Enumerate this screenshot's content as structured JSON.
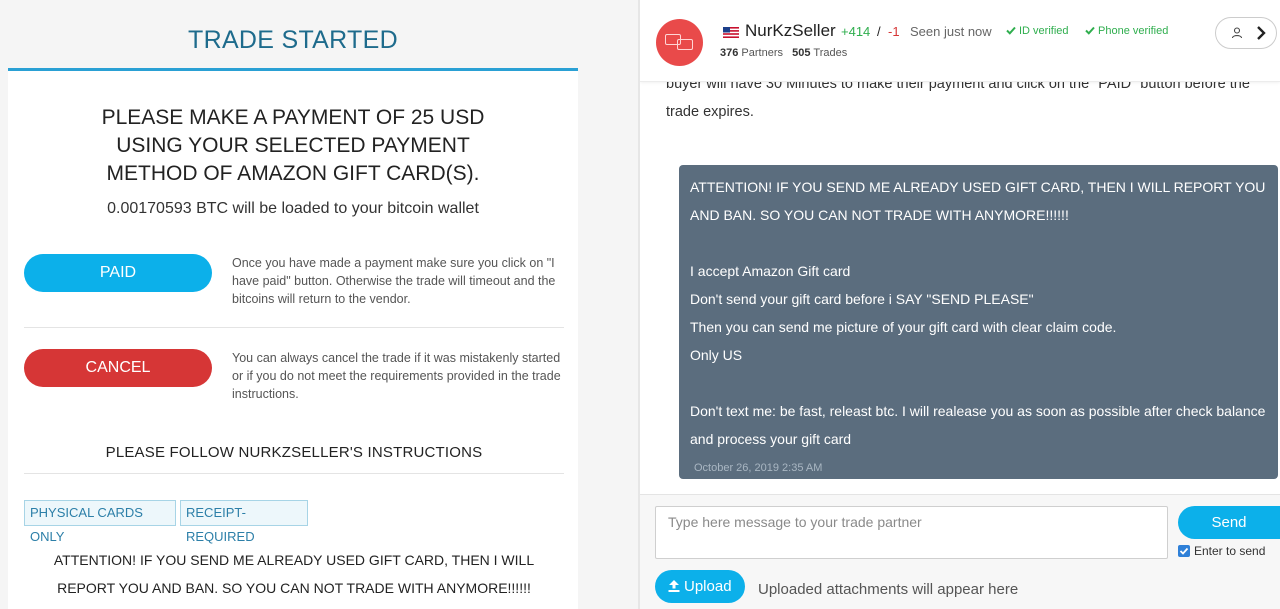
{
  "trade": {
    "title": "TRADE STARTED",
    "payment_heading": "PLEASE MAKE A PAYMENT OF 25 USD USING YOUR SELECTED PAYMENT METHOD OF AMAZON GIFT CARD(S).",
    "btc_line": "0.00170593 BTC will be loaded to your bitcoin wallet",
    "paid_label": "PAID",
    "paid_text": "Once you have made a payment make sure you click on \"I have paid\" button. Otherwise the trade will timeout and the bitcoins will return to the vendor.",
    "cancel_label": "CANCEL",
    "cancel_text": "You can always cancel the trade if it was mistakenly started or if you do not meet the requirements provided in the trade instructions.",
    "instructions_heading": "PLEASE FOLLOW NURKZSELLER'S INSTRUCTIONS",
    "tags": [
      "PHYSICAL CARDS ONLY",
      "RECEIPT-REQUIRED"
    ],
    "attention_text": "ATTENTION! IF YOU SEND ME ALREADY USED GIFT CARD, THEN I WILL REPORT YOU AND BAN. SO YOU CAN NOT TRADE WITH ANYMORE!!!!!!"
  },
  "seller": {
    "name": "NurKzSeller",
    "rep_positive": "+414",
    "rep_slash": "/",
    "rep_negative": "-1",
    "seen": "Seen just now",
    "id_verified": "ID verified",
    "phone_verified": "Phone verified",
    "partners_count": "376",
    "partners_label": "Partners",
    "trades_count": "505",
    "trades_label": "Trades"
  },
  "chat": {
    "previous_text": "buyer will have 30 Minutes to make their payment and click on the \"PAID\" button before the trade expires.",
    "message_lines": [
      "ATTENTION! IF YOU SEND ME ALREADY USED GIFT CARD, THEN I WILL REPORT YOU AND BAN. SO YOU CAN NOT TRADE WITH ANYMORE!!!!!!",
      "",
      "I accept Amazon Gift card",
      "Don't send your gift card before i SAY \"SEND PLEASE\"",
      "Then you can send me picture of your gift card with clear claim code.",
      "Only US",
      "",
      "Don't text me: be fast, releast btc. I will realease you as soon as possible after check balance and process your gift card"
    ],
    "message_time": "October 26, 2019 2:35 AM"
  },
  "compose": {
    "placeholder": "Type here message to your trade partner",
    "send_label": "Send",
    "enter_to_send_label": "Enter to send",
    "upload_label": "Upload",
    "attachments_text": "Uploaded attachments will appear here"
  },
  "colors": {
    "accent_blue": "#0cb0ea",
    "cancel_red": "#d63636",
    "bubble_slate": "#5b6d7e",
    "verified_green": "#2fae4e"
  }
}
